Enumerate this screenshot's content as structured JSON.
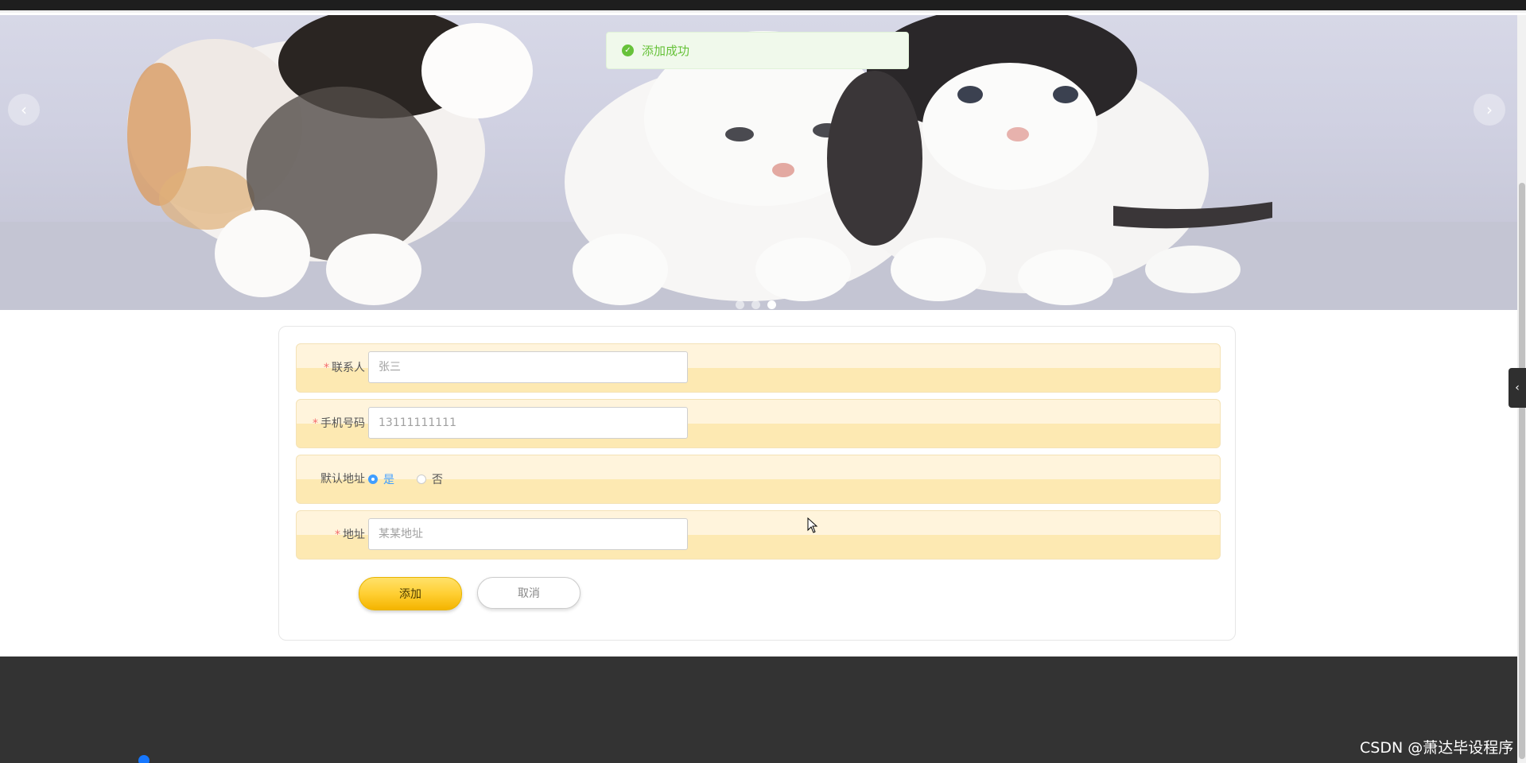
{
  "toast": {
    "message": "添加成功",
    "icon": "check-circle-icon",
    "color": "#67c23a"
  },
  "carousel": {
    "prev_symbol": "‹",
    "next_symbol": "›",
    "slide_count": 3,
    "active_index": 2,
    "image": "three-kittens"
  },
  "form": {
    "contact": {
      "label": "联系人",
      "required_mark": "*",
      "value": "张三"
    },
    "phone": {
      "label": "手机号码",
      "required_mark": "*",
      "value": "13111111111"
    },
    "default_address": {
      "label": "默认地址",
      "options": [
        "是",
        "否"
      ],
      "selected": "是"
    },
    "address": {
      "label": "地址",
      "required_mark": "*",
      "value": "某某地址"
    },
    "add_button": "添加",
    "cancel_button": "取消"
  },
  "side_tab": {
    "symbol": "‹"
  },
  "watermark": "CSDN @萧达毕设程序",
  "colors": {
    "accent_yellow": "#ffcf33",
    "row_bg": "#fde9b2",
    "radio_blue": "#409eff",
    "required_red": "#f56c6c",
    "footer": "#333333"
  }
}
